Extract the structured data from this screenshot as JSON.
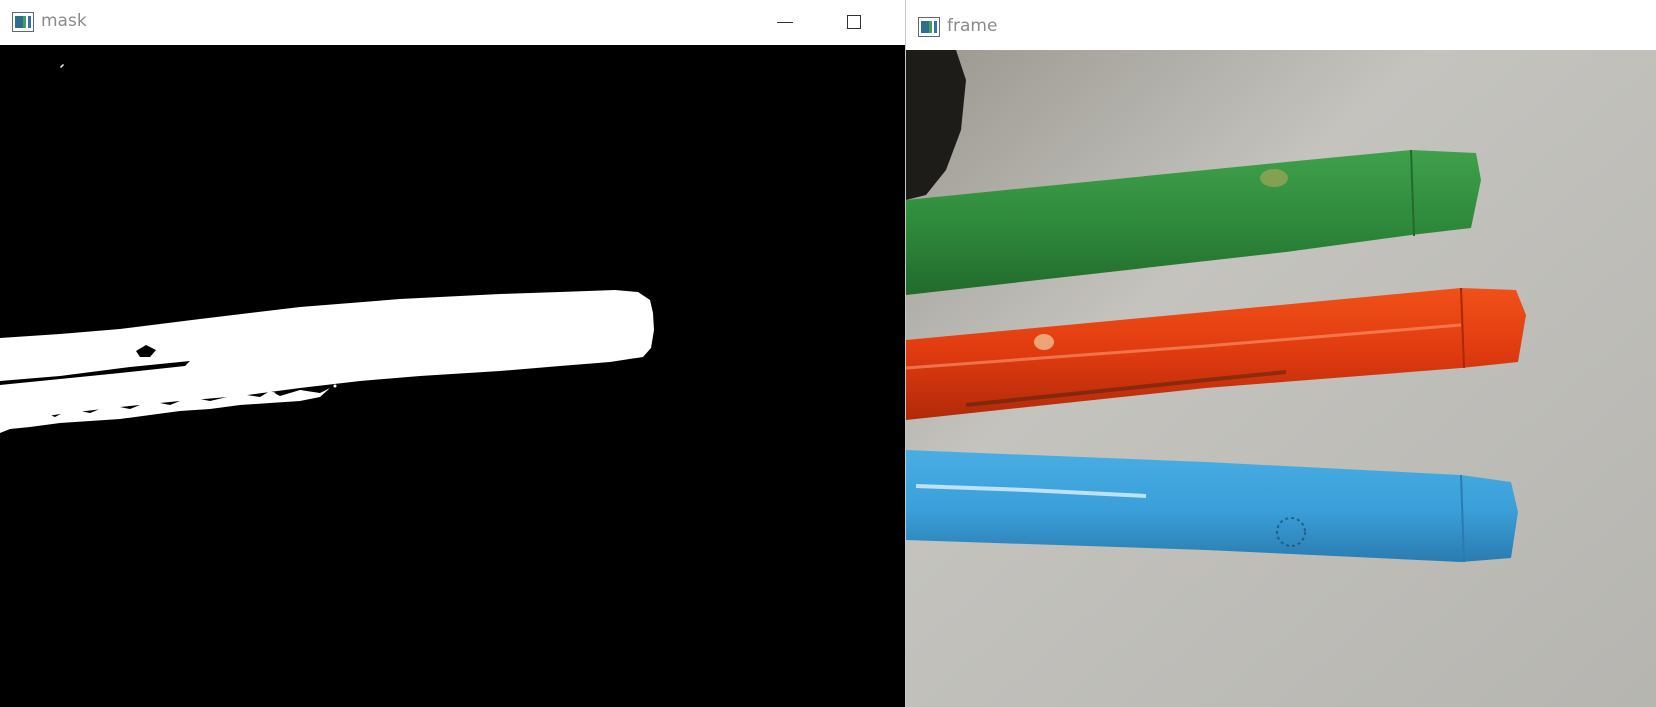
{
  "windows": {
    "mask": {
      "title": "mask"
    },
    "frame": {
      "title": "frame"
    }
  },
  "icons": {
    "app": "opencv-window-icon",
    "minimize": "minimize-icon",
    "maximize": "maximize-icon"
  },
  "colors": {
    "mask_background": "#000000",
    "mask_foreground": "#ffffff",
    "frame_background": "#bdbcb6",
    "green_pen": "#2e8a3e",
    "red_pen": "#e03a10",
    "blue_pen": "#3a9ed8",
    "title_text": "#8a8a8a"
  }
}
